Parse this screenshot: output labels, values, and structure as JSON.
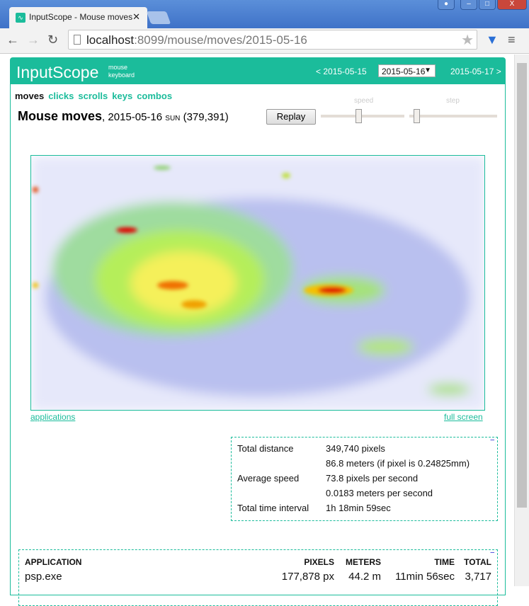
{
  "browser": {
    "tab_title": "InputScope - Mouse moves",
    "tab_close": "✕",
    "url_host": "localhost",
    "url_rest": ":8099/mouse/moves/2015-05-16"
  },
  "header": {
    "brand": "InputScope",
    "sub_links": [
      "mouse",
      "keyboard"
    ],
    "prev_date": "< 2015-05-15",
    "selected_date": "2015-05-16",
    "next_date": "2015-05-17 >"
  },
  "tabs": [
    {
      "label": "moves",
      "active": true
    },
    {
      "label": "clicks"
    },
    {
      "label": "scrolls"
    },
    {
      "label": "keys"
    },
    {
      "label": "combos"
    }
  ],
  "title": {
    "main": "Mouse moves",
    "date": ", 2015-05-16 ",
    "dow": "SUN",
    "count": " (379,391)"
  },
  "controls": {
    "replay": "Replay",
    "speed_label": "speed",
    "step_label": "step",
    "speed_value": 0.45,
    "step_value": 0.05
  },
  "links": {
    "applications": "applications",
    "full_screen": "full screen"
  },
  "stats": [
    {
      "label": "Total distance",
      "value": "349,740 pixels"
    },
    {
      "label": "",
      "value": "86.8 meters (if pixel is 0.24825mm)"
    },
    {
      "label": "Average speed",
      "value": "73.8 pixels per second"
    },
    {
      "label": "",
      "value": "0.0183 meters per second"
    },
    {
      "label": "Total time interval",
      "value": "1h 18min 59sec"
    }
  ],
  "apps": {
    "headers": [
      "APPLICATION",
      "PIXELS",
      "METERS",
      "TIME",
      "TOTAL"
    ],
    "rows": [
      {
        "application": "psp.exe",
        "pixels": "177,878 px",
        "meters": "44.2 m",
        "time": "11min 56sec",
        "total": "3,717"
      }
    ]
  },
  "colors": {
    "accent": "#1bbc9b"
  }
}
